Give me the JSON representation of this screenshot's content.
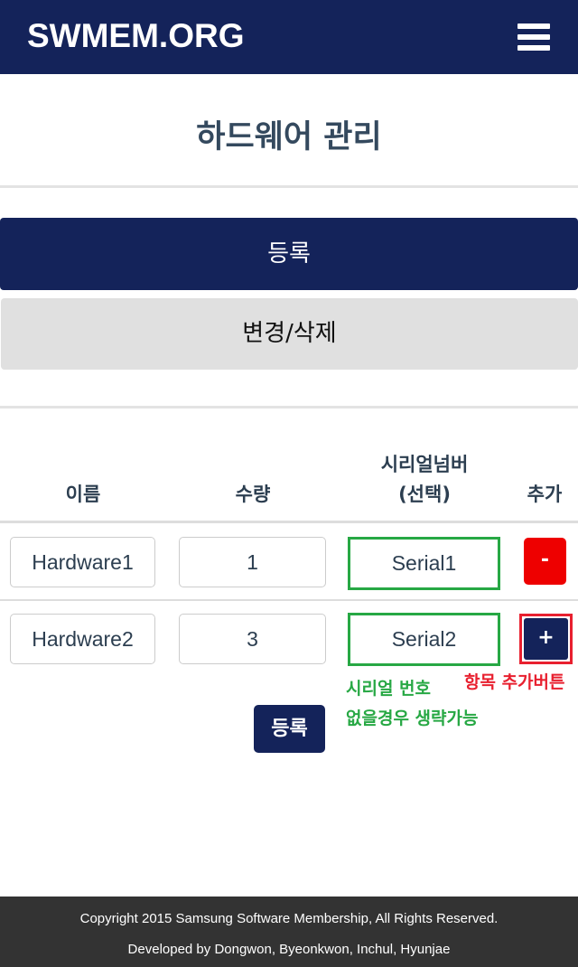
{
  "navbar": {
    "brand": "SWMEM.ORG",
    "menu_icon": "hamburger-icon"
  },
  "page": {
    "title": "하드웨어 관리"
  },
  "tabs": {
    "register_label": "등록",
    "edit_label": "변경/삭제"
  },
  "table": {
    "headers": {
      "name": "이름",
      "quantity": "수량",
      "serial_line1": "시리얼넘버",
      "serial_line2": "(선택)",
      "add": "추가"
    },
    "rows": [
      {
        "name": "Hardware1",
        "quantity": "1",
        "serial": "Serial1",
        "action_label": "-"
      },
      {
        "name": "Hardware2",
        "quantity": "3",
        "serial": "Serial2",
        "action_label": "+"
      }
    ]
  },
  "annotations": {
    "serial_note_line1": "시리얼 번호",
    "serial_note_line2": "없을경우 생략가능",
    "add_button_note": "항목 추가버튼",
    "serial_color": "#27a844",
    "add_color": "#e8202f"
  },
  "submit_label": "등록",
  "footer": {
    "copyright": "Copyright 2015 Samsung Software Membership, All Rights Reserved.",
    "credits": "Developed by Dongwon, Byeonkwon, Inchul, Hyunjae"
  },
  "colors": {
    "primary": "#14235a",
    "danger": "#ee0000",
    "footer_bg": "#333333",
    "tab_inactive": "#e0e0e0"
  }
}
